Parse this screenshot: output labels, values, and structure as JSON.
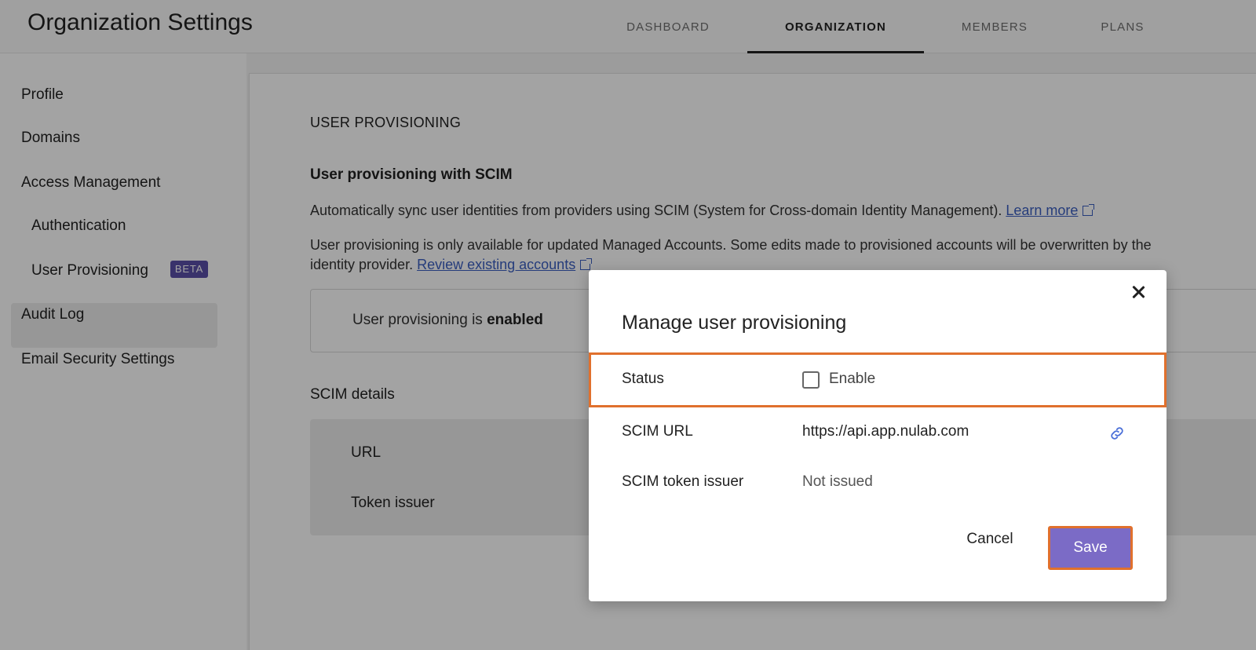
{
  "header": {
    "title": "Organization Settings",
    "tabs": [
      {
        "label": "DASHBOARD",
        "active": false
      },
      {
        "label": "ORGANIZATION",
        "active": true
      },
      {
        "label": "MEMBERS",
        "active": false
      },
      {
        "label": "PLANS",
        "active": false
      }
    ]
  },
  "sidebar": {
    "items": [
      {
        "label": "Profile"
      },
      {
        "label": "Domains"
      },
      {
        "label": "Access Management"
      },
      {
        "label": "Authentication"
      },
      {
        "label": "User Provisioning",
        "badge": "BETA",
        "active": true
      },
      {
        "label": "Audit Log"
      },
      {
        "label": "Email Security Settings"
      }
    ]
  },
  "main": {
    "section_title": "USER PROVISIONING",
    "subtitle": "User provisioning with SCIM",
    "description": "Automatically sync user identities from providers using SCIM (System for Cross-domain Identity Management).",
    "learn_more": "Learn more",
    "note": "User provisioning is only available for updated Managed Accounts. Some edits made to provisioned accounts will be overwritten by the identity provider.",
    "review_link": "Review existing accounts",
    "status_prefix": "User provisioning is",
    "status_value": "enabled",
    "scim_title": "SCIM details",
    "scim_url_label": "URL",
    "scim_token_label": "Token issuer"
  },
  "dialog": {
    "title": "Manage user provisioning",
    "status_label": "Status",
    "enable_label": "Enable",
    "enable_checked": false,
    "scim_url_label": "SCIM URL",
    "scim_url_value": "https://api.app.nulab.com",
    "token_label": "SCIM token issuer",
    "token_value": "Not issued",
    "cancel_label": "Cancel",
    "save_label": "Save"
  },
  "colors": {
    "accent": "#7b6bc6",
    "highlight": "#e0702d",
    "beta_badge": "#5a4fa8",
    "link": "#3b5fc0"
  },
  "icons": [
    "close-icon",
    "link-icon",
    "external-link-icon",
    "checkbox"
  ]
}
